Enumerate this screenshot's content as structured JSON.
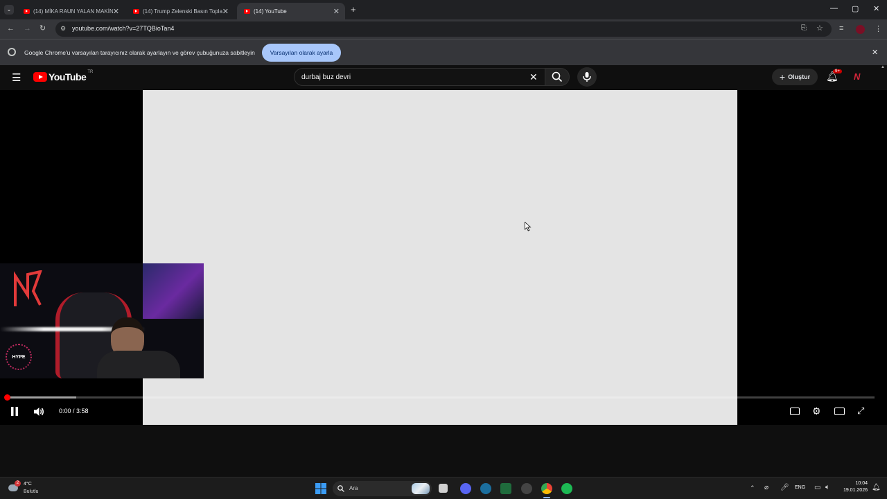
{
  "browser": {
    "tabs": [
      {
        "label": "(14) MİKA RAUN YALAN MAKİN"
      },
      {
        "label": "(14) Trump Zelenski Basın Topla"
      },
      {
        "label": "(14) YouTube"
      }
    ],
    "url": "youtube.com/watch?v=27TQBioTan4"
  },
  "infobar": {
    "text": "Google Chrome'u varsayılan tarayıcınız olarak ayarlayın ve görev çubuğunuza sabitleyin",
    "button": "Varsayılan olarak ayarla"
  },
  "youtube": {
    "logo_text": "YouTube",
    "region": "TR",
    "search_value": "durbaj buz devri",
    "create_label": "Oluştur",
    "notif_count": "9+"
  },
  "player": {
    "time": "0:00 / 3:58",
    "progress_fraction": 0.0,
    "buffered_fraction": 0.08,
    "webcam_overlay_text": "HYPE"
  },
  "taskbar": {
    "weather_temp": "4°C",
    "weather_desc": "Bulutlu",
    "weather_badge": "2",
    "search_placeholder": "Ara",
    "lang": "ENG",
    "clock_time": "10:04",
    "clock_date": "19.01.2026"
  }
}
